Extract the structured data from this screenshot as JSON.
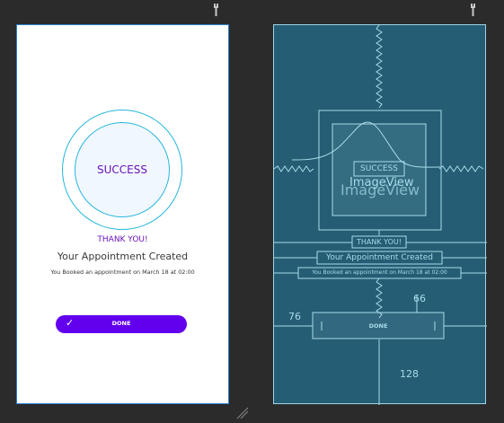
{
  "design": {
    "success_label": "SUCCESS",
    "thanks": "THANK YOU!",
    "created": "Your Appointment Created",
    "booked": "You Booked an appointment on March 18 at 02:00",
    "done_label": "DONE",
    "check_glyph": "✓"
  },
  "blueprint": {
    "image_view_1": "ImageView",
    "image_view_2": "ImageView",
    "success_label": "SUCCESS",
    "thanks": "THANK YOU!",
    "created": "Your Appointment Created",
    "booked": "You Booked an appointment on March 18 at 02:00",
    "done_label": "DONE",
    "margin_top": "66",
    "margin_left": "76",
    "margin_bottom": "128"
  },
  "icons": {
    "wrench": "wrench-icon"
  },
  "colors": {
    "accent_purple": "#6200ee",
    "text_purple": "#6a14b8",
    "ring": "#25b6dc",
    "blueprint_bg": "#255d74",
    "blueprint_line": "#a8dbe9"
  }
}
